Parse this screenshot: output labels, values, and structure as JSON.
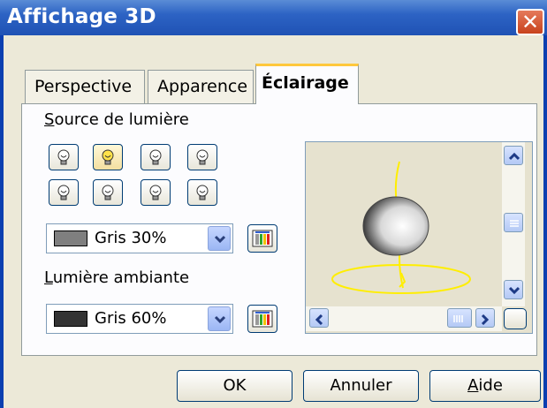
{
  "window": {
    "title": "Affichage 3D",
    "close_glyph": "✕"
  },
  "tabs": [
    {
      "label": "Perspective",
      "active": false
    },
    {
      "label": "Apparence",
      "active": false
    },
    {
      "label": "Éclairage",
      "active": true
    }
  ],
  "light_source": {
    "label_mnemonic": "S",
    "label_rest": "ource de lumière",
    "bulb_icons": [
      "light-bulb-icon",
      "light-bulb-icon",
      "light-bulb-icon",
      "light-bulb-icon",
      "light-bulb-icon",
      "light-bulb-icon",
      "light-bulb-icon",
      "light-bulb-icon"
    ],
    "selected_bulb_index": 1,
    "color_value": "Gris 30%",
    "color_hex": "#7f7f7f"
  },
  "ambient_light": {
    "label_mnemonic": "L",
    "label_rest": "umière ambiante",
    "color_value": "Gris 60%",
    "color_hex": "#333333"
  },
  "buttons": {
    "ok": "OK",
    "cancel": "Annuler",
    "help_mnemonic": "A",
    "help_rest": "ide"
  },
  "colors": {
    "titlebar": "#2d63c4",
    "active_tab_accent": "#ffc83c",
    "light_beam": "#ffee00"
  }
}
